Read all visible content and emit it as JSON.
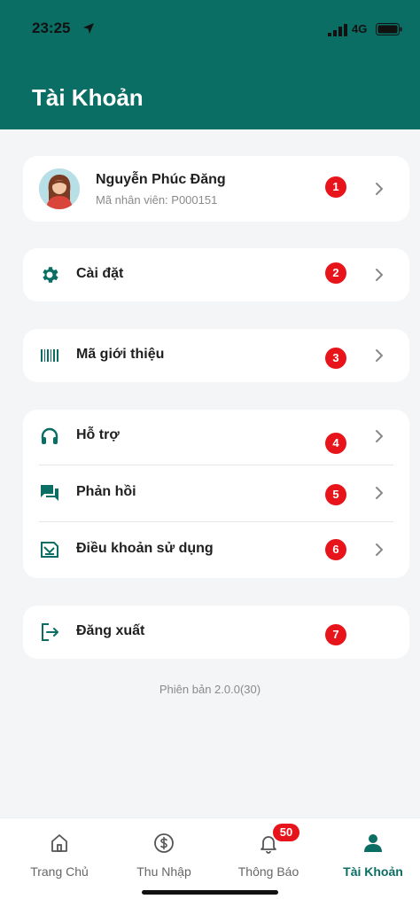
{
  "status_bar": {
    "time": "23:25",
    "network": "4G"
  },
  "header": {
    "title": "Tài Khoản"
  },
  "profile": {
    "name": "Nguyễn Phúc Đăng",
    "employee_id": "Mã nhân viên: P000151",
    "badge": "1"
  },
  "menu": {
    "settings": {
      "label": "Cài đặt",
      "icon": "gear-icon",
      "badge": "2"
    },
    "referral": {
      "label": "Mã giới thiệu",
      "icon": "barcode-icon",
      "badge": "3"
    },
    "support": {
      "label": "Hỗ trợ",
      "icon": "headphones-icon",
      "badge": "4"
    },
    "feedback": {
      "label": "Phản hồi",
      "icon": "chat-icon",
      "badge": "5"
    },
    "terms": {
      "label": "Điều khoản sử dụng",
      "icon": "document-icon",
      "badge": "6"
    },
    "logout": {
      "label": "Đăng xuất",
      "icon": "logout-icon",
      "badge": "7"
    }
  },
  "version": "Phiên bản 2.0.0(30)",
  "tabs": [
    {
      "label": "Trang Chủ",
      "icon": "home-icon",
      "active": false
    },
    {
      "label": "Thu Nhập",
      "icon": "dollar-icon",
      "active": false
    },
    {
      "label": "Thông Báo",
      "icon": "bell-icon",
      "active": false,
      "badge": "50"
    },
    {
      "label": "Tài Khoản",
      "icon": "user-icon",
      "active": true
    }
  ],
  "colors": {
    "primary": "#0b6e64",
    "badge": "#e8141b",
    "background": "#f4f5f7"
  }
}
